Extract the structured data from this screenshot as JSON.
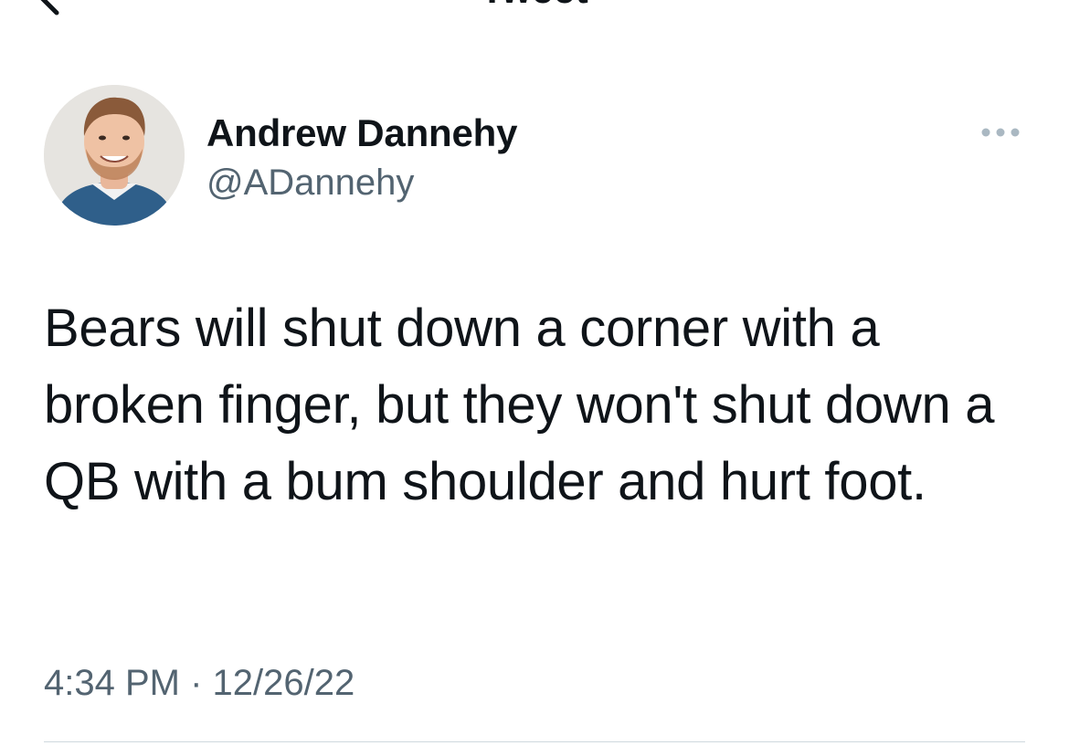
{
  "nav": {
    "title": "Tweet",
    "back_icon": "chevron-left-icon"
  },
  "author": {
    "name": "Andrew Dannehy",
    "handle": "@ADannehy",
    "avatar_icon": "avatar"
  },
  "more_icon": "more-horizontal-icon",
  "tweet": {
    "text": "Bears will shut down a corner with a broken finger, but they won't shut down a QB with a bum shoulder and hurt foot.",
    "time": "4:34 PM",
    "separator": "·",
    "date": "12/26/22"
  },
  "colors": {
    "text_primary": "#0f1419",
    "text_secondary": "#536471",
    "divider": "#cfd9de"
  }
}
